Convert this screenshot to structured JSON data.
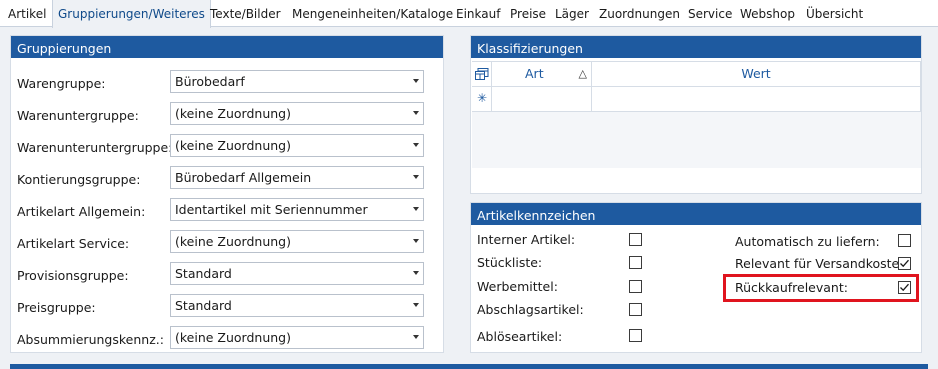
{
  "tabs": [
    {
      "label": "Artikel"
    },
    {
      "label": "Gruppierungen/Weiteres"
    },
    {
      "label": "Texte/Bilder"
    },
    {
      "label": "Mengeneinheiten/Kataloge"
    },
    {
      "label": "Einkauf"
    },
    {
      "label": "Preise"
    },
    {
      "label": "Läger"
    },
    {
      "label": "Zuordnungen"
    },
    {
      "label": "Service"
    },
    {
      "label": "Webshop"
    },
    {
      "label": "Übersicht"
    }
  ],
  "active_tab": "Gruppierungen/Weiteres",
  "gruppierungen": {
    "title": "Gruppierungen",
    "rows": [
      {
        "label": "Warengruppe:",
        "value": "Bürobedarf"
      },
      {
        "label": "Warenuntergruppe:",
        "value": "(keine Zuordnung)"
      },
      {
        "label": "Warenunteruntergruppe:",
        "value": "(keine Zuordnung)"
      },
      {
        "label": "Kontierungsgruppe:",
        "value": "Bürobedarf Allgemein"
      },
      {
        "label": "Artikelart Allgemein:",
        "value": "Identartikel mit Seriennummer"
      },
      {
        "label": "Artikelart Service:",
        "value": "(keine Zuordnung)"
      },
      {
        "label": "Provisionsgruppe:",
        "value": "Standard"
      },
      {
        "label": "Preisgruppe:",
        "value": "Standard"
      },
      {
        "label": "Absummierungskennz.:",
        "value": "(keine Zuordnung)"
      }
    ]
  },
  "klassifizierungen": {
    "title": "Klassifizierungen",
    "col_art": "Art",
    "col_wert": "Wert",
    "sort_glyph": "△",
    "new_row_glyph": "✳"
  },
  "artikelkennzeichen": {
    "title": "Artikelkennzeichen",
    "left": [
      {
        "label": "Interner Artikel:",
        "checked": false
      },
      {
        "label": "Stückliste:",
        "checked": false
      },
      {
        "label": "Werbemittel:",
        "checked": false
      },
      {
        "label": "Abschlagsartikel:",
        "checked": false
      },
      {
        "label": "Ablöseartikel:",
        "checked": false
      }
    ],
    "right": [
      {
        "label": "Automatisch zu liefern:",
        "checked": false
      },
      {
        "label": "Relevant für Versandkosten",
        "checked": true
      },
      {
        "label": "Rückkaufrelevant:",
        "checked": true
      }
    ]
  },
  "colors": {
    "header_blue": "#1e5aa0",
    "highlight_red": "#e0141e"
  }
}
